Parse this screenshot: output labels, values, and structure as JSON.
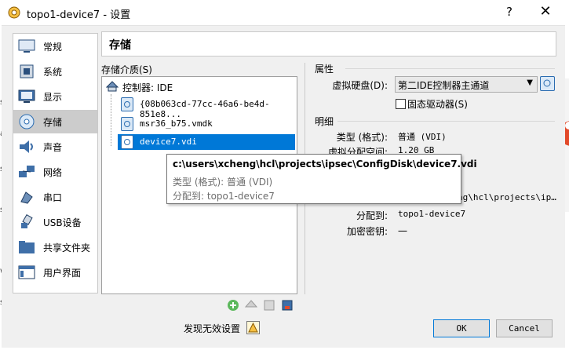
{
  "window": {
    "title": "topo1-device7 - 设置",
    "help": "?",
    "close": "✕"
  },
  "nav": [
    {
      "label": "常规",
      "icon": "general-icon"
    },
    {
      "label": "系统",
      "icon": "system-icon"
    },
    {
      "label": "显示",
      "icon": "display-icon"
    },
    {
      "label": "存储",
      "icon": "storage-icon"
    },
    {
      "label": "声音",
      "icon": "audio-icon"
    },
    {
      "label": "网络",
      "icon": "network-icon"
    },
    {
      "label": "串口",
      "icon": "serial-port-icon"
    },
    {
      "label": "USB设备",
      "icon": "usb-icon"
    },
    {
      "label": "共享文件夹",
      "icon": "shared-folder-icon"
    },
    {
      "label": "用户界面",
      "icon": "user-interface-icon"
    }
  ],
  "header": {
    "title": "存储"
  },
  "storage": {
    "label": "存储介质(S)",
    "controller": "控制器: IDE",
    "items": [
      {
        "label": "{08b063cd-77cc-46a6-be4d-851e8..."
      },
      {
        "label": "msr36_b75.vmdk"
      },
      {
        "label": "device7.vdi"
      }
    ]
  },
  "properties": {
    "section": "属性",
    "disk_label": "虚拟硬盘(D):",
    "disk_value": "第二IDE控制器主通道",
    "ssd_label": "固态驱动器(S)"
  },
  "details": {
    "section": "明细",
    "type_label": "类型 (格式):",
    "type_value": "普通 (VDI)",
    "vsize_label": "虚拟分配空间:",
    "vsize_value": "1.20 GB",
    "location_partial": "ng\\hcl\\projects\\ip…",
    "attached_label": "分配到:",
    "attached_value": "topo1-device7",
    "encrypt_label": "加密密钥:",
    "encrypt_value": "一"
  },
  "tooltip": {
    "path": "c:\\users\\xcheng\\hcl\\projects\\ipsec\\ConfigDisk\\device7.vdi",
    "type": "类型 (格式): 普通 (VDI)",
    "attached": "分配到: topo1-device7"
  },
  "footer": {
    "invalid_settings": "发现无效设置",
    "ok": "OK",
    "cancel": "Cancel"
  },
  "colors": {
    "selection": "#0078d7",
    "nav_selected": "#cccccc",
    "dialog_bg": "#f0f0f0"
  }
}
